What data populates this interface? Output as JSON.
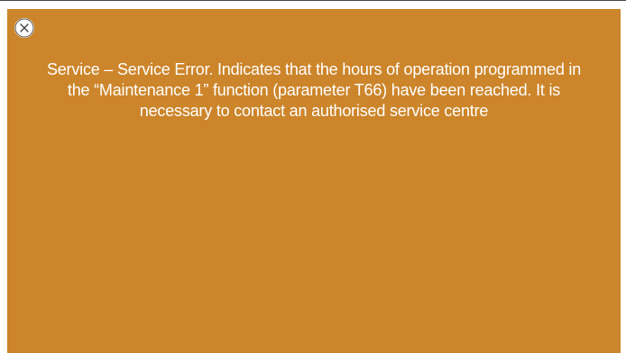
{
  "dialog": {
    "close_icon": "close-icon",
    "message": "Service – Service Error. Indicates that the hours of operation programmed in the “Maintenance 1” function (parameter T66) have been reached. It is necessary to contact an authorised service centre",
    "background_color": "#cc852a",
    "text_color": "#ffffff"
  }
}
